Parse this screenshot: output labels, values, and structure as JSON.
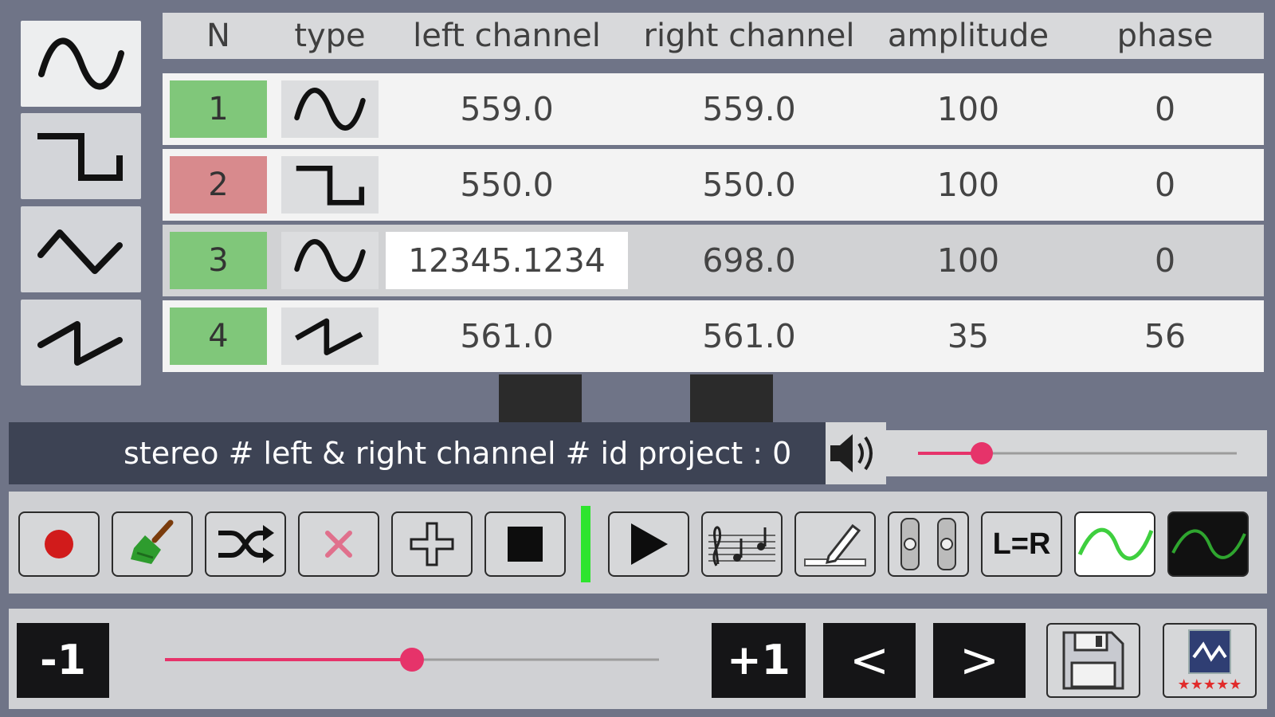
{
  "waveform_selector": [
    "sine-wave-icon",
    "square-wave-icon",
    "triangle-wave-icon",
    "sawtooth-wave-icon"
  ],
  "table": {
    "headers": {
      "n": "N",
      "type": "type",
      "left": "left channel",
      "right": "right channel",
      "amplitude": "amplitude",
      "phase": "phase"
    },
    "rows": [
      {
        "n": "1",
        "type": "sine",
        "left": "559.0",
        "right": "559.0",
        "amplitude": "100",
        "phase": "0",
        "status_color": "#80c77a"
      },
      {
        "n": "2",
        "type": "square",
        "left": "550.0",
        "right": "550.0",
        "amplitude": "100",
        "phase": "0",
        "status_color": "#d88a8d"
      },
      {
        "n": "3",
        "type": "sine",
        "left": "12345.1234",
        "right": "698.0",
        "amplitude": "100",
        "phase": "0",
        "status_color": "#80c77a"
      },
      {
        "n": "4",
        "type": "sawtooth",
        "left": "561.0",
        "right": "561.0",
        "amplitude": "35",
        "phase": "56",
        "status_color": "#80c77a"
      }
    ]
  },
  "status": {
    "text": "stereo # left & right channel # id project : 0"
  },
  "volume": {
    "level": 0.2,
    "icon": "speaker-icon"
  },
  "toolbar": {
    "lr_label": "L=R",
    "icons": [
      "record-icon",
      "broom-icon",
      "shuffle-icon",
      "delete-icon",
      "add-icon",
      "stop-icon",
      "play-icon",
      "music-notes-icon",
      "pencil-icon",
      "lr-sliders-icon",
      "l-equals-r-icon",
      "waveform-light-icon",
      "waveform-dark-icon"
    ]
  },
  "bottom": {
    "minus_label": "-1",
    "plus_label": "+1",
    "prev_label": "<",
    "next_label": ">",
    "slider_level": 0.5,
    "icons": [
      "save-icon",
      "rate-app-icon"
    ]
  },
  "colors": {
    "accent": "#e6336a",
    "active_green": "#2ee42e"
  }
}
